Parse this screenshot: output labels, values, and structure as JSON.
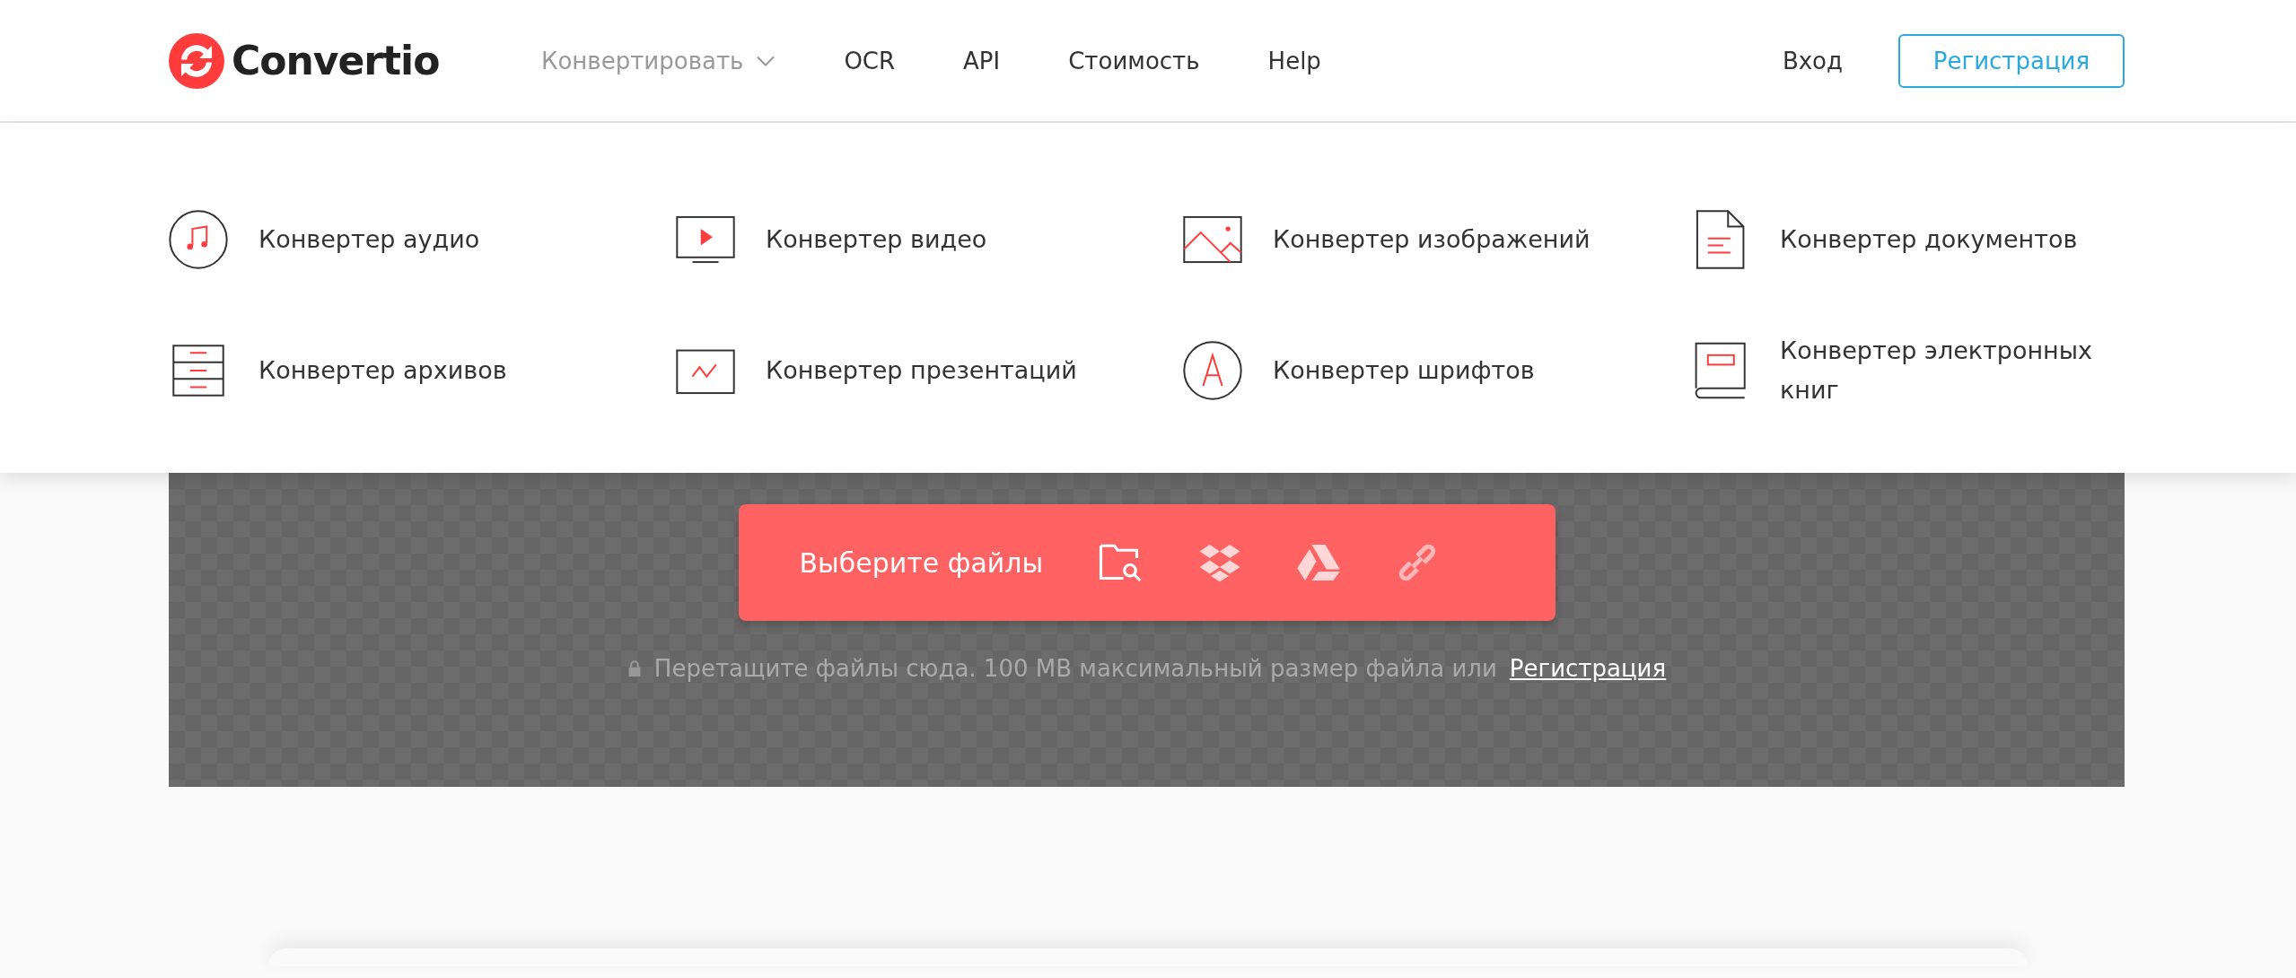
{
  "header": {
    "logo": "Convertio",
    "nav": [
      {
        "label": "Конвертировать",
        "expanded": true,
        "has_menu": true
      },
      {
        "label": "OCR",
        "expanded": false,
        "has_menu": false
      },
      {
        "label": "API",
        "expanded": false,
        "has_menu": false
      },
      {
        "label": "Стоимость",
        "expanded": false,
        "has_menu": false
      },
      {
        "label": "Help",
        "expanded": false,
        "has_menu": false
      }
    ],
    "login": "Вход",
    "register": "Регистрация"
  },
  "menu": [
    {
      "kind": "audio",
      "label": "Конвертер аудио"
    },
    {
      "kind": "video",
      "label": "Конвертер видео"
    },
    {
      "kind": "image",
      "label": "Конвертер изображений"
    },
    {
      "kind": "document",
      "label": "Конвертер документов"
    },
    {
      "kind": "archive",
      "label": "Конвертер архивов"
    },
    {
      "kind": "presentation",
      "label": "Конвертер презентаций"
    },
    {
      "kind": "font",
      "label": "Конвертер шрифтов"
    },
    {
      "kind": "ebook",
      "label": "Конвертер электронных книг"
    }
  ],
  "upload": {
    "button": "Выберите файлы",
    "sources": [
      {
        "kind": "computer"
      },
      {
        "kind": "dropbox"
      },
      {
        "kind": "drive"
      },
      {
        "kind": "url"
      }
    ],
    "hint": "Перетащите файлы сюда. 100 MB максимальный размер файла или",
    "hint_link": "Регистрация"
  }
}
